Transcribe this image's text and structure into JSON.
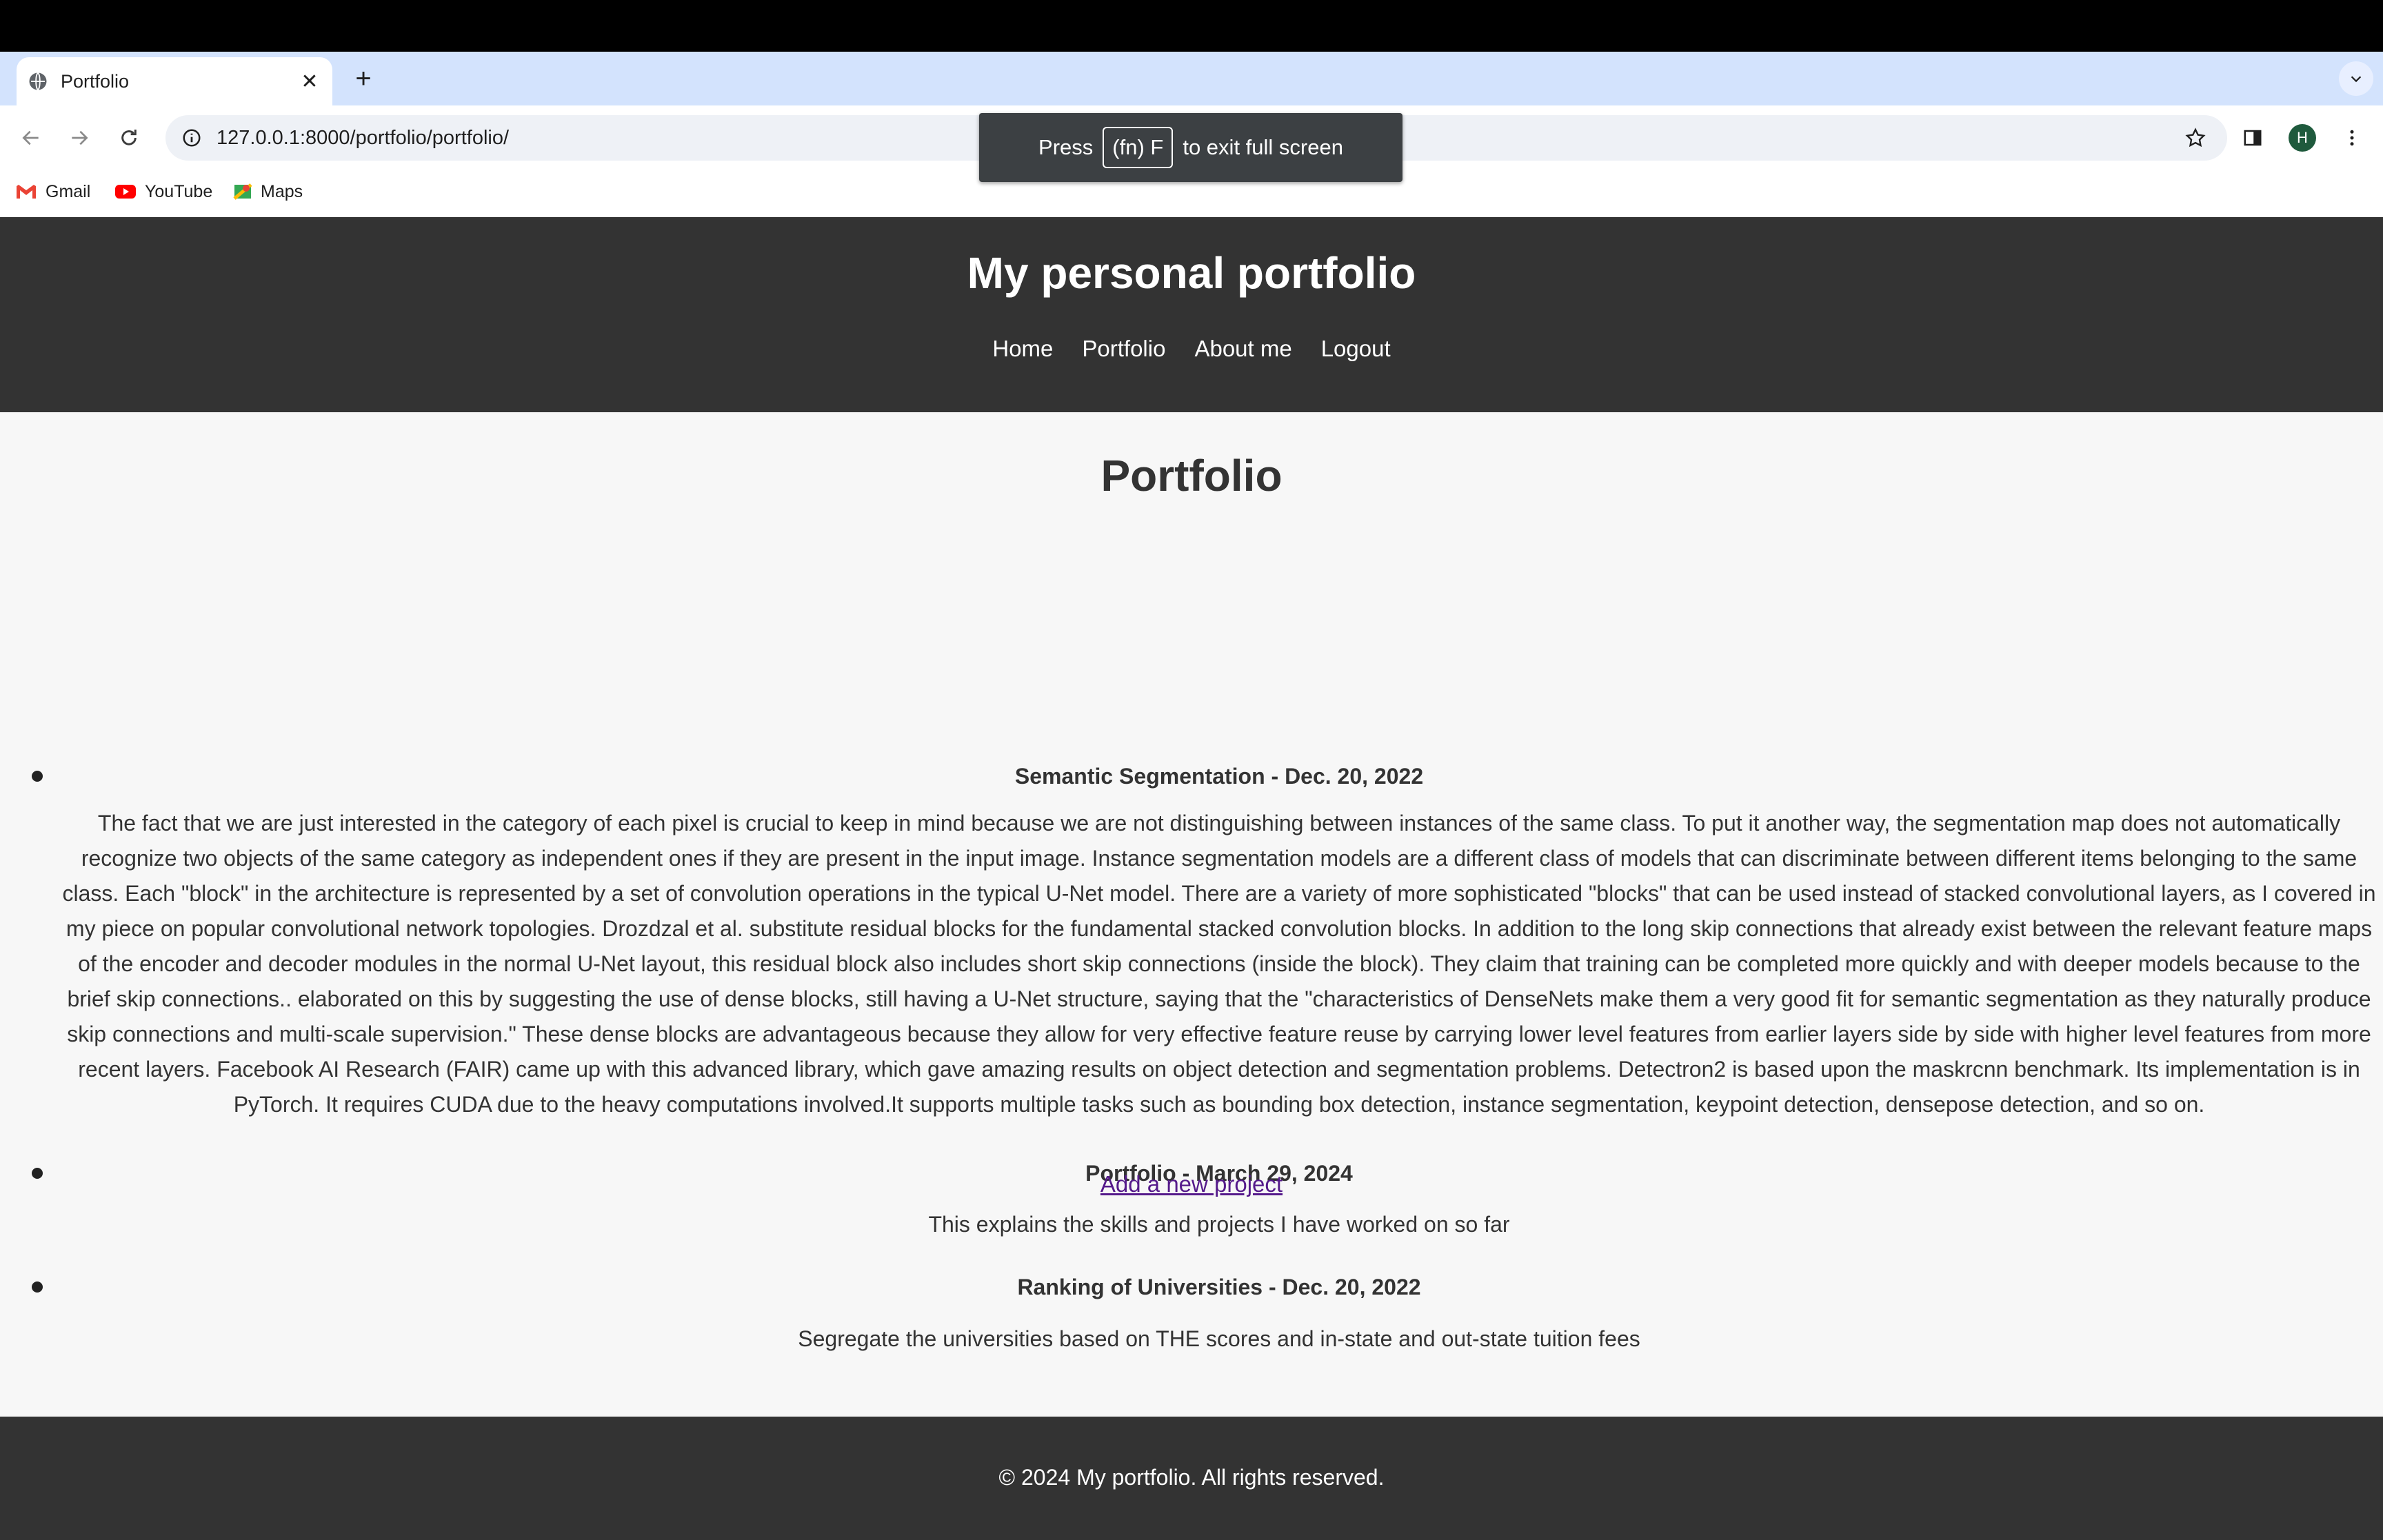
{
  "browser": {
    "tab_title": "Portfolio",
    "url": "127.0.0.1:8000/portfolio/portfolio/",
    "profile_initial": "H",
    "bookmarks": [
      {
        "label": "Gmail",
        "icon": "gmail-icon"
      },
      {
        "label": "YouTube",
        "icon": "youtube-icon"
      },
      {
        "label": "Maps",
        "icon": "maps-icon"
      }
    ],
    "fullscreen_toast": {
      "prefix": "Press",
      "key": "(fn) F",
      "suffix": "to exit full screen"
    }
  },
  "site": {
    "title": "My personal portfolio",
    "nav": [
      "Home",
      "Portfolio",
      "About me",
      "Logout"
    ]
  },
  "main": {
    "heading": "Portfolio",
    "projects": [
      {
        "title": "Semantic Segmentation - Dec. 20, 2022",
        "description_lines": [
          "The fact that we are just interested in the category of each pixel is crucial to keep in mind because we are not distinguishing between instances of the same class. To put it another way, the segmentation map does not automatically",
          "recognize two objects of the same category as independent ones if they are present in the input image. Instance segmentation models are a different class of models that can discriminate between different items belonging to the same",
          "class. Each \"block\" in the architecture is represented by a set of convolution operations in the typical U-Net model. There are a variety of more sophisticated \"blocks\" that can be used instead of stacked convolutional layers, as I covered in",
          "my piece on popular convolutional network topologies. Drozdzal et al. substitute residual blocks for the fundamental stacked convolution blocks. In addition to the long skip connections that already exist between the relevant feature maps",
          "of the encoder and decoder modules in the normal U-Net layout, this residual block also includes short skip connections (inside the block). They claim that training can be completed more quickly and with deeper models because to the",
          "brief skip connections.. elaborated on this by suggesting the use of dense blocks, still having a U-Net structure, saying that the \"characteristics of DenseNets make them a very good fit for semantic segmentation as they naturally produce",
          "skip connections and multi-scale supervision.\" These dense blocks are advantageous because they allow for very effective feature reuse by carrying lower level features from earlier layers side by side with higher level features from more",
          "recent layers. Facebook AI Research (FAIR) came up with this advanced library, which gave amazing results on object detection and segmentation problems. Detectron2 is based upon the maskrcnn benchmark. Its implementation is in",
          "PyTorch. It requires CUDA due to the heavy computations involved.It supports multiple tasks such as bounding box detection, instance segmentation, keypoint detection, densepose detection, and so on."
        ]
      },
      {
        "title": "Portfolio - March 29, 2024",
        "description_lines": [
          "This explains the skills and projects I have worked on so far"
        ]
      },
      {
        "title": "Ranking of Universities - Dec. 20, 2022",
        "description_lines": [
          "Segregate the universities based on THE scores and in-state and out-state tuition fees"
        ]
      }
    ],
    "add_link": "Add a new project"
  },
  "footer": {
    "text": "© 2024 My portfolio. All rights reserved."
  }
}
